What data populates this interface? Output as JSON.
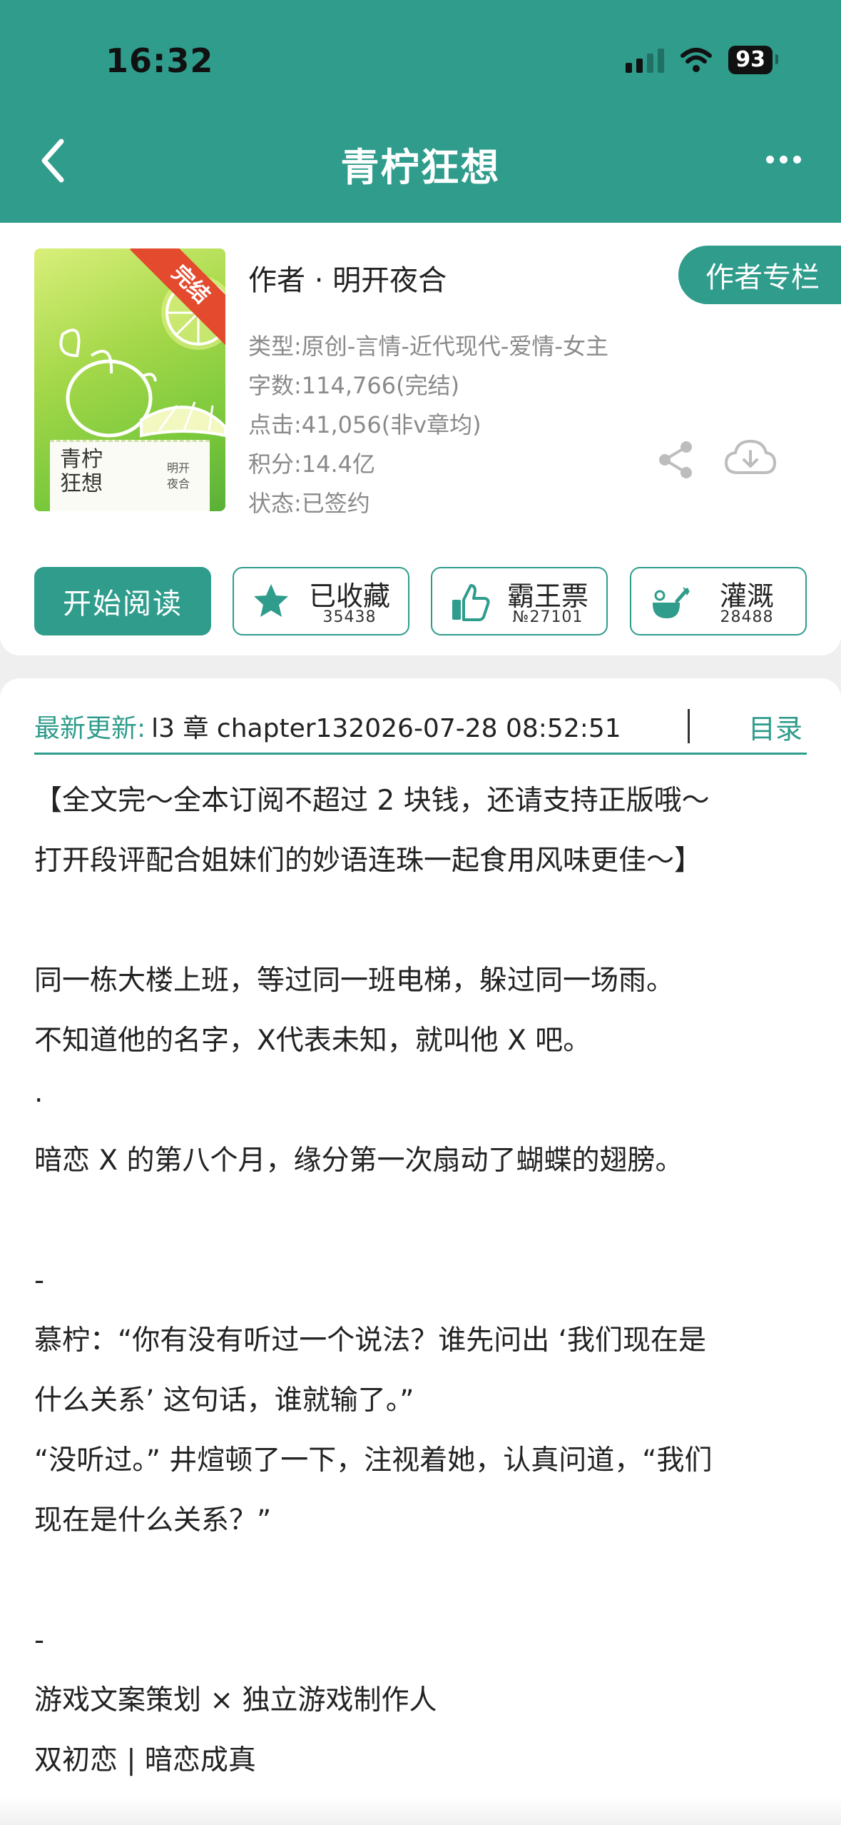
{
  "status_bar": {
    "time": "16:32",
    "battery": "93"
  },
  "nav": {
    "title": "青柠狂想"
  },
  "book": {
    "cover_title": "青柠狂想",
    "cover_author": "明开夜合",
    "cover_ribbon": "完结",
    "author_line": "作者 · 明开夜合",
    "author_column_label": "作者专栏",
    "meta": {
      "genre": "类型:原创-言情-近代现代-爱情-女主",
      "words": "字数:114,766(完结)",
      "clicks": "点击:41,056(非v章均)",
      "points": "积分:14.4亿",
      "status": "状态:已签约"
    }
  },
  "actions": {
    "read_label": "开始阅读",
    "favorite": {
      "label": "已收藏",
      "count": "35438"
    },
    "ticket": {
      "label": "霸王票",
      "count": "№27101"
    },
    "water": {
      "label": "灌溉",
      "count": "28488"
    }
  },
  "latest": {
    "label": "最新更新:",
    "text": "l3 章 chapter132026-07-28 08:52:51",
    "toc_label": "目录"
  },
  "synopsis": [
    "【全文完～全本订阅不超过 2 块钱，还请支持正版哦～",
    "打开段评配合姐妹们的妙语连珠一起食用风味更佳～】",
    "",
    "同一栋大楼上班，等过同一班电梯，躲过同一场雨。",
    "不知道他的名字，X代表未知，就叫他 X 吧。",
    "·",
    "暗恋 X 的第八个月，缘分第一次扇动了蝴蝶的翅膀。",
    "",
    "-",
    "慕柠：“你有没有听过一个说法？谁先问出 ‘我们现在是",
    "什么关系’ 这句话，谁就输了。”",
    "“没听过。” 井煊顿了一下，注视着她，认真问道，“我们",
    "现在是什么关系？”",
    "",
    "-",
    "游戏文案策划 × 独立游戏制作人",
    "双初恋 | 暗恋成真"
  ],
  "colors": {
    "accent": "#2f9c8c",
    "ribbon": "#e34a2e"
  },
  "icons": [
    "back-icon",
    "more-icon",
    "share-icon",
    "download-icon",
    "star-icon",
    "thumbs-up-icon",
    "watering-can-icon",
    "signal-icon",
    "wifi-icon",
    "battery-icon"
  ]
}
